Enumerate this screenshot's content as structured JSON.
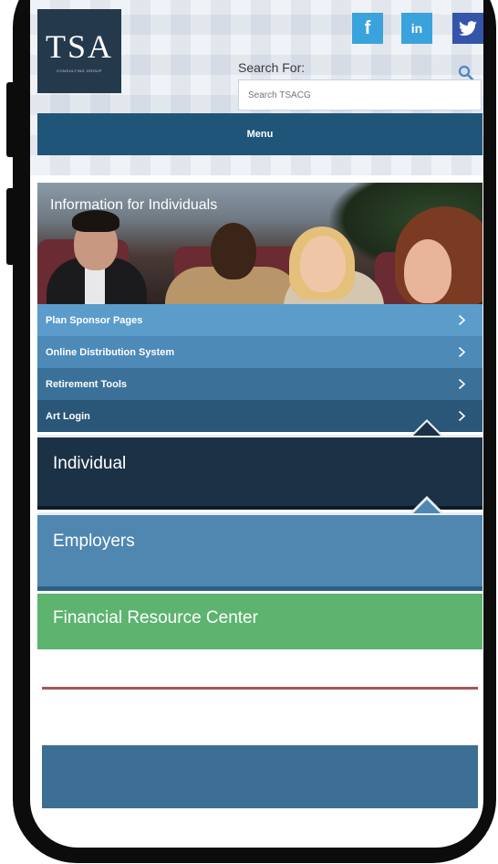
{
  "header": {
    "logo_text": "TSA",
    "logo_subtext": "CONSULTING GROUP",
    "social": {
      "facebook": "f",
      "linkedin": "in"
    },
    "search_label": "Search For:",
    "search_placeholder": "Search TSACG",
    "menu_label": "Menu"
  },
  "hero": {
    "title": "Information for Individuals"
  },
  "nav": {
    "items": [
      {
        "label": "Plan Sponsor Pages",
        "color": "#5b9ccb"
      },
      {
        "label": "Online Distribution System",
        "color": "#4d8ab8"
      },
      {
        "label": "Retirement Tools",
        "color": "#3b7199"
      },
      {
        "label": "Art Login",
        "color": "#2a5678"
      }
    ]
  },
  "tabs": {
    "individual": {
      "label": "Individual",
      "color": "#1b3145"
    },
    "employers": {
      "label": "Employers",
      "color": "#4f87b0"
    },
    "financial": {
      "label": "Financial Resource Center",
      "color": "#5cb46e"
    }
  },
  "colors": {
    "menu_bar": "#20557a",
    "logo_bg": "#243a4c",
    "divider": "#a55656",
    "bottom_block": "#3c6f93"
  }
}
